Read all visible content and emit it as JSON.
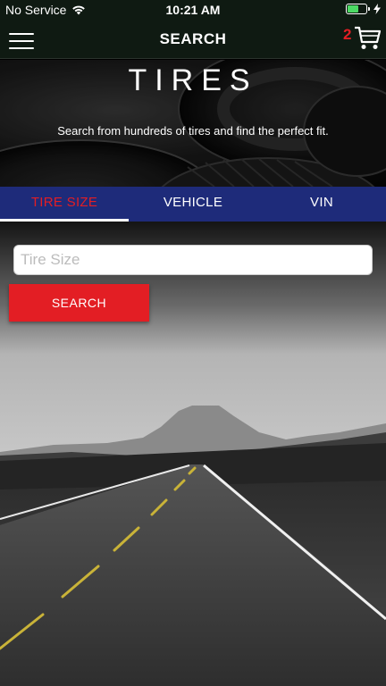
{
  "status_bar": {
    "carrier": "No Service",
    "time": "10:21 AM",
    "battery_level": 0.6,
    "wifi_icon": "wifi-icon",
    "charging_icon": "bolt-icon"
  },
  "nav": {
    "title": "SEARCH",
    "menu_icon": "hamburger-menu-icon",
    "cart_icon": "shopping-cart-icon",
    "cart_count": "2"
  },
  "hero": {
    "title": "TIRES",
    "subtitle": "Search from hundreds of tires and find the perfect fit."
  },
  "tabs": [
    {
      "label": "TIRE SIZE",
      "active": true
    },
    {
      "label": "VEHICLE",
      "active": false
    },
    {
      "label": "VIN",
      "active": false
    }
  ],
  "search": {
    "placeholder": "Tire Size",
    "value": "",
    "button_label": "SEARCH"
  },
  "colors": {
    "accent_red": "#e31e24",
    "tab_bar": "#1e2b7a",
    "nav_bg": "#0f1a12"
  }
}
